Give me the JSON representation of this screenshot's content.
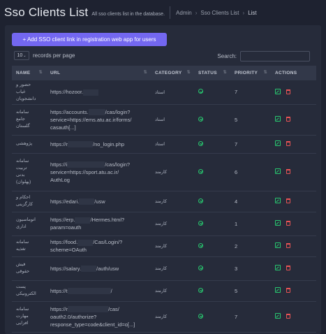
{
  "header": {
    "title": "Sso Clients List",
    "subtitle": "All sso clients list in the database.",
    "breadcrumbs": [
      "Admin",
      "Sso Clients List",
      "List"
    ]
  },
  "toolbar": {
    "add_button": "+ Add SSO client link in registration web app for users",
    "length_value": "10",
    "records_per_page": "records per page",
    "search_label": "Search:"
  },
  "table": {
    "columns": [
      "NAME",
      "URL",
      "CATEGORY",
      "STATUS",
      "PRIORITY",
      "ACTIONS"
    ],
    "rows": [
      {
        "name_lines": [
          "حضور و",
          "غیاب",
          "دانشجویان"
        ],
        "url_lines": [
          "https://hozoor."
        ],
        "category": "استاد",
        "priority": "7"
      },
      {
        "name_lines": [
          "سامانه",
          "جامع",
          "گلستان"
        ],
        "url_lines": [
          "https://accounts.",
          "/cas/login?",
          "service=https://ems.atu.ac.ir/forms/",
          "casauth[...]"
        ],
        "category": "استاد",
        "priority": "5"
      },
      {
        "name_lines": [
          "پژوهشی"
        ],
        "url_lines": [
          "https://r",
          "/no_login.php"
        ],
        "category": "استاد",
        "priority": "7"
      },
      {
        "name_lines": [
          "سامانه",
          "تربیت",
          "بدنی",
          "(پهلوان)"
        ],
        "url_lines": [
          "https://i",
          "/cas/login?",
          "service=https://sport.atu.ac.ir/",
          "AuthLog"
        ],
        "category": "کارمند",
        "priority": "6"
      },
      {
        "name_lines": [
          "احکام و",
          "کارگزینی"
        ],
        "url_lines": [
          "https://edari.",
          "/usw"
        ],
        "category": "کارمند",
        "priority": "4"
      },
      {
        "name_lines": [
          "اتوماسیون",
          "اداری"
        ],
        "url_lines": [
          "https://erp.",
          "/Hermes.html?",
          "param=oauth"
        ],
        "category": "کارمند",
        "priority": "1"
      },
      {
        "name_lines": [
          "سامانه",
          "تغذیه"
        ],
        "url_lines": [
          "https://food.",
          "/Cas/Login/?",
          "scheme=OAuth"
        ],
        "category": "کارمند",
        "priority": "2"
      },
      {
        "name_lines": [
          "فیش",
          "حقوقی"
        ],
        "url_lines": [
          "https://salary.",
          "/auth/usw"
        ],
        "category": "کارمند",
        "priority": "3"
      },
      {
        "name_lines": [
          "پست",
          "الکترونیکی"
        ],
        "url_lines": [
          "https://t",
          "/"
        ],
        "category": "کارمند",
        "priority": "5"
      },
      {
        "name_lines": [
          "سامانه",
          "مهارت",
          "افزایی"
        ],
        "url_lines": [
          "https://r",
          "/cas/",
          "oauth2.0/authorize?",
          "response_type=code&client_id=o[...]"
        ],
        "category": "کارمند",
        "priority": "7"
      }
    ]
  },
  "colors": {
    "background": "#1e2230",
    "card": "#262b3a",
    "accent": "#7367f0",
    "success": "#28c76f",
    "danger": "#ea5455"
  },
  "icons": {
    "status": "check-circle-icon",
    "edit": "edit-icon",
    "delete": "trash-icon"
  }
}
